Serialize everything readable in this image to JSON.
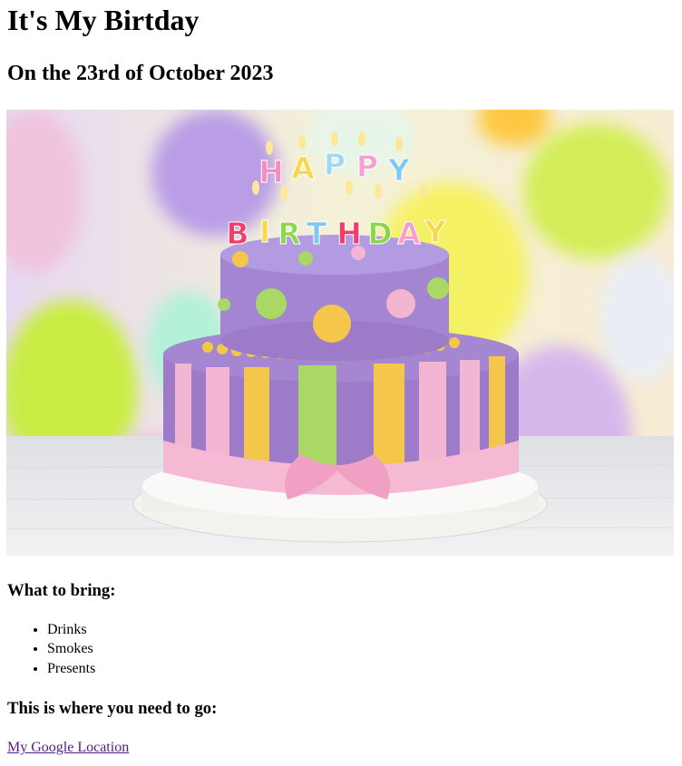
{
  "page": {
    "title": "It's My Birtday",
    "subtitle": "On the 23rd of October 2023"
  },
  "photo": {
    "candle_top": [
      "H",
      "A",
      "P",
      "P",
      "Y"
    ],
    "candle_bottom": [
      "B",
      "I",
      "R",
      "T",
      "H",
      "D",
      "A",
      "Y"
    ],
    "colors": {
      "balloon_purple": "#b79ae6",
      "balloon_green": "#c8ee3a",
      "balloon_yellow": "#f6f25e",
      "cake_purple": "#9d7bc9",
      "icing_pink": "#f2b6d2",
      "icing_lime": "#a9d864"
    }
  },
  "bring": {
    "heading": "What to bring:",
    "items": [
      "Drinks",
      "Smokes",
      "Presents"
    ]
  },
  "location": {
    "heading": "This is where you need to go:",
    "link_text": "My Google Location"
  },
  "colors": {
    "link_visited": "#551a8b"
  }
}
